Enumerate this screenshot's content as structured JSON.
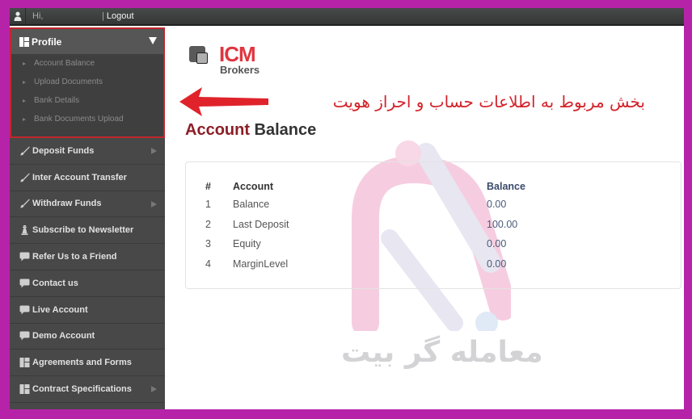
{
  "topbar": {
    "greeting": "Hi,",
    "separator": "|",
    "logout_label": "Logout"
  },
  "sidebar": {
    "profile": {
      "label": "Profile",
      "sub_items": [
        {
          "label": "Account Balance"
        },
        {
          "label": "Upload Documents"
        },
        {
          "label": "Bank Details"
        },
        {
          "label": "Bank Documents Upload"
        }
      ]
    },
    "items": [
      {
        "label": "Deposit Funds",
        "icon": "brush-icon",
        "has_submenu": true
      },
      {
        "label": "Inter Account Transfer",
        "icon": "brush-icon",
        "has_submenu": false
      },
      {
        "label": "Withdraw Funds",
        "icon": "brush-icon",
        "has_submenu": true
      },
      {
        "label": "Subscribe to Newsletter",
        "icon": "chess-pawn-icon",
        "has_submenu": false
      },
      {
        "label": "Refer Us to a Friend",
        "icon": "speech-bubble-icon",
        "has_submenu": false
      },
      {
        "label": "Contact us",
        "icon": "speech-bubble-icon",
        "has_submenu": false
      },
      {
        "label": "Live Account",
        "icon": "speech-bubble-icon",
        "has_submenu": false
      },
      {
        "label": "Demo Account",
        "icon": "speech-bubble-icon",
        "has_submenu": false
      },
      {
        "label": "Agreements and Forms",
        "icon": "grid-icon",
        "has_submenu": false
      },
      {
        "label": "Contract Specifications",
        "icon": "grid-icon",
        "has_submenu": true
      }
    ]
  },
  "logo": {
    "brand": "ICM",
    "sub": "Brokers"
  },
  "annotation": {
    "text": "بخش مربوط به اطلاعات حساب و احراز هویت",
    "color": "#d3232b"
  },
  "page_title": {
    "accent": "Account",
    "rest": " Balance",
    "accent_color": "#8b1e26"
  },
  "table": {
    "headers": [
      "#",
      "Account",
      "Balance"
    ],
    "rows": [
      {
        "num": "1",
        "account": "Balance",
        "balance": "0.00"
      },
      {
        "num": "2",
        "account": "Last Deposit",
        "balance": "100.00"
      },
      {
        "num": "3",
        "account": "Equity",
        "balance": "0.00"
      },
      {
        "num": "4",
        "account": "MarginLevel",
        "balance": "0.00"
      }
    ]
  },
  "watermark": {
    "text": "معامله گر بیت"
  },
  "colors": {
    "frame": "#b623a8",
    "highlight_border": "#c0272d",
    "sidebar_bg": "#484848"
  }
}
